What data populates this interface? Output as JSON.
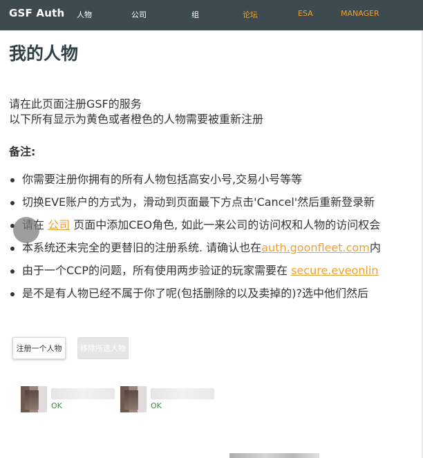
{
  "navbar": {
    "brand": "GSF Auth",
    "items": [
      {
        "label": "人物"
      },
      {
        "label": "公司"
      },
      {
        "label": "组"
      },
      {
        "label": "论坛"
      },
      {
        "label": "ESA"
      },
      {
        "label": "MANAGER"
      }
    ]
  },
  "page": {
    "title": "我的人物",
    "intro_line1": "请在此页面注册GSF的服务",
    "intro_line2": "以下所有显示为黄色或者橙色的人物需要被重新注册",
    "notes_heading": "备注:",
    "notes": {
      "n1": "你需要注册你拥有的所有人物包括高安小号,交易小号等等",
      "n2": "切换EVE账户的方式为，滑动到页面最下方点击'Cancel'然后重新登录新",
      "n3_before": "请在 ",
      "n3_link": "公司",
      "n3_after": " 页面中添加CEO角色, 如此一来公司的访问权和人物的访问权会",
      "n4_before": "本系统还未完全的更替旧的注册系统. 请确认也在",
      "n4_link": "auth.goonfleet.com",
      "n4_after": "内",
      "n5_before": "由于一个CCP的问题，所有使用两步验证的玩家需要在 ",
      "n5_link": "secure.eveonlin",
      "n6": "是不是有人物已经不属于你了呢(包括删除的以及卖掉的)?选中他们然后"
    }
  },
  "buttons": {
    "register": "注册一个人物",
    "remove": "移除所选人物"
  },
  "characters": [
    {
      "status": "OK"
    },
    {
      "status": "OK"
    }
  ],
  "colors": {
    "navbar_bg": "#3d4b50",
    "accent_orange": "#f0a030",
    "status_ok": "#3c8a3c"
  }
}
